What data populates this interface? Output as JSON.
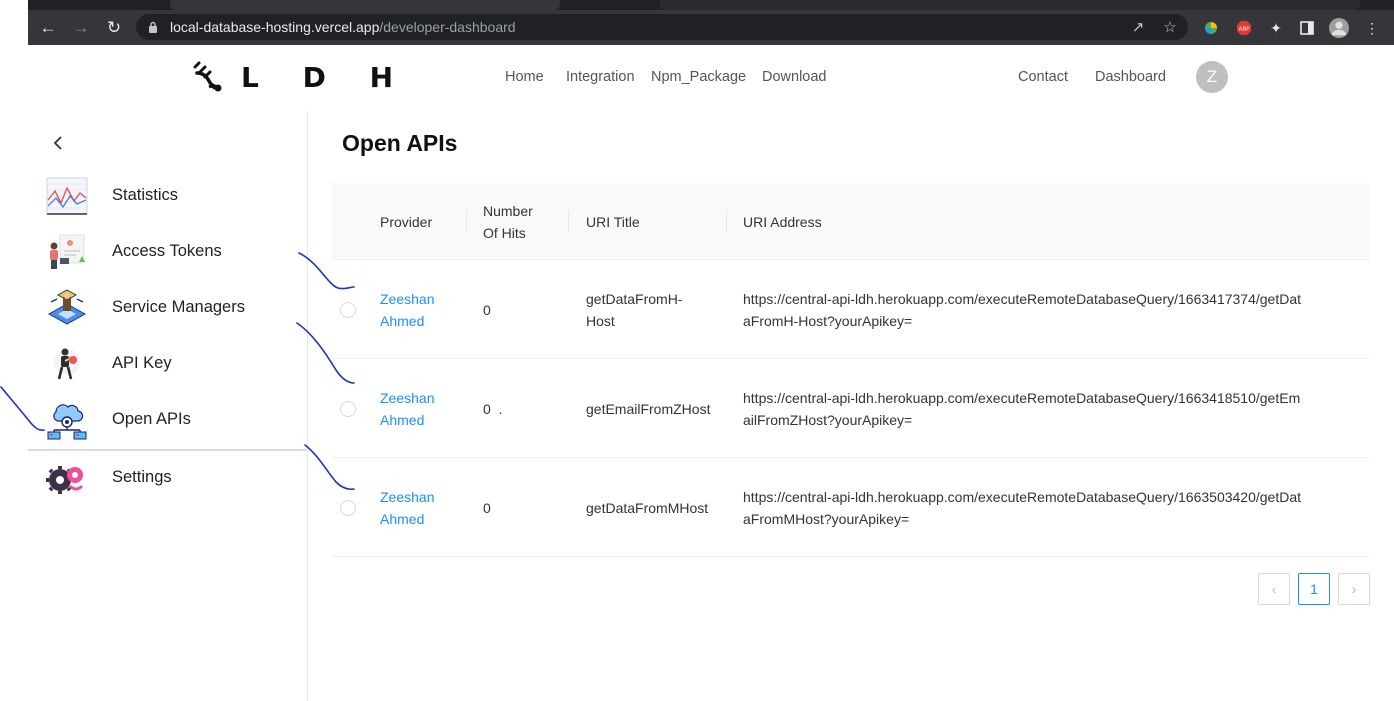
{
  "browser": {
    "url_host": "local-database-hosting.vercel.app",
    "url_path": "/developer-dashboard"
  },
  "header": {
    "logo_text": "L D H",
    "nav": [
      "Home",
      "Integration",
      "Npm_Package",
      "Download"
    ],
    "right_nav": [
      "Contact",
      "Dashboard"
    ],
    "avatar_letter": "Z"
  },
  "sidebar": {
    "items": [
      {
        "label": "Statistics",
        "icon": "statistics-chart-icon"
      },
      {
        "label": "Access Tokens",
        "icon": "access-tokens-icon"
      },
      {
        "label": "Service Managers",
        "icon": "service-managers-icon"
      },
      {
        "label": "API Key",
        "icon": "api-key-icon"
      },
      {
        "label": "Open APIs",
        "icon": "open-apis-network-icon"
      },
      {
        "label": "Settings",
        "icon": "settings-gears-icon"
      }
    ]
  },
  "main": {
    "title": "Open APIs",
    "columns": [
      "Provider",
      "Number Of Hits",
      "URI Title",
      "URI Address"
    ],
    "rows": [
      {
        "provider": "Zeeshan Ahmed",
        "hits": "0",
        "title": "getDataFromH-Host",
        "address": "https://central-api-ldh.herokuapp.com/executeRemoteDatabaseQuery/1663417374/getDataFromH-Host?yourApikey="
      },
      {
        "provider": "Zeeshan Ahmed",
        "hits": "0  .",
        "title": "getEmailFromZHost",
        "address": "https://central-api-ldh.herokuapp.com/executeRemoteDatabaseQuery/1663418510/getEmailFromZHost?yourApikey="
      },
      {
        "provider": "Zeeshan Ahmed",
        "hits": "0",
        "title": "getDataFromMHost",
        "address": "https://central-api-ldh.herokuapp.com/executeRemoteDatabaseQuery/1663503420/getDataFromMHost?yourApikey="
      }
    ],
    "pagination": {
      "prev": "‹",
      "current_page": "1",
      "next": "›"
    }
  },
  "colors": {
    "link": "#1890ff",
    "annotation_ink": "#1a33c8",
    "chrome_bg": "#35363a"
  }
}
